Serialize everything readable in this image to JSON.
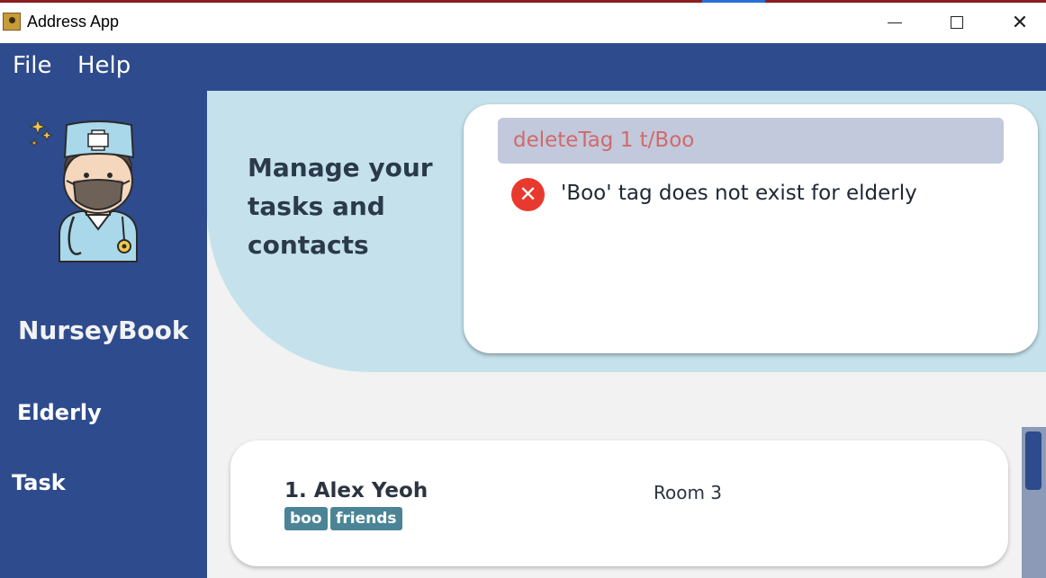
{
  "window": {
    "title": "Address App"
  },
  "menu": {
    "file": "File",
    "help": "Help"
  },
  "sidebar": {
    "brand": "NurseyBook",
    "nav": [
      {
        "label": "Elderly"
      },
      {
        "label": "Task"
      }
    ]
  },
  "header": {
    "tagline": "Manage your tasks and contacts",
    "command_value": "deleteTag 1 t/Boo",
    "result_message": "'Boo' tag does not exist for elderly",
    "error_icon": "close-icon"
  },
  "list": [
    {
      "index_name": "1. Alex Yeoh",
      "room": "Room 3",
      "tags": [
        "boo",
        "friends"
      ]
    }
  ],
  "colors": {
    "primary": "#2e4b8d",
    "header_bg": "#c5e2ec",
    "error": "#e8392e",
    "tag": "#4b8496"
  }
}
